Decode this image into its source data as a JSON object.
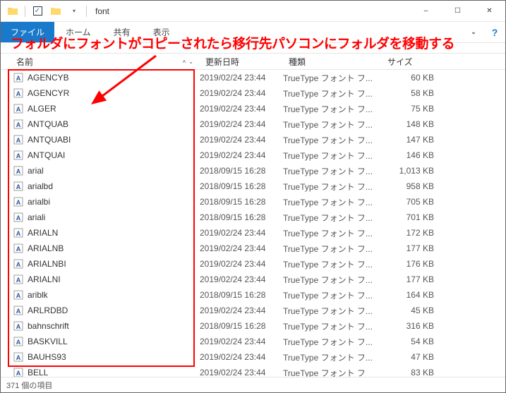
{
  "window": {
    "title": "font",
    "minimize": "–",
    "maximize": "☐",
    "close": "✕"
  },
  "ribbon": {
    "file": "ファイル",
    "home": "ホーム",
    "share": "共有",
    "view": "表示",
    "help": "?"
  },
  "annotation": "フォルダにフォントがコピーされたら移行先パソコンにフォルダを移動する",
  "columns": {
    "name": "名前",
    "date": "更新日時",
    "type": "種類",
    "size": "サイズ"
  },
  "files": [
    {
      "name": "AGENCYB",
      "date": "2019/02/24 23:44",
      "type": "TrueType フォント フ...",
      "size": "60 KB"
    },
    {
      "name": "AGENCYR",
      "date": "2019/02/24 23:44",
      "type": "TrueType フォント フ...",
      "size": "58 KB"
    },
    {
      "name": "ALGER",
      "date": "2019/02/24 23:44",
      "type": "TrueType フォント フ...",
      "size": "75 KB"
    },
    {
      "name": "ANTQUAB",
      "date": "2019/02/24 23:44",
      "type": "TrueType フォント フ...",
      "size": "148 KB"
    },
    {
      "name": "ANTQUABI",
      "date": "2019/02/24 23:44",
      "type": "TrueType フォント フ...",
      "size": "147 KB"
    },
    {
      "name": "ANTQUAI",
      "date": "2019/02/24 23:44",
      "type": "TrueType フォント フ...",
      "size": "146 KB"
    },
    {
      "name": "arial",
      "date": "2018/09/15 16:28",
      "type": "TrueType フォント フ...",
      "size": "1,013 KB"
    },
    {
      "name": "arialbd",
      "date": "2018/09/15 16:28",
      "type": "TrueType フォント フ...",
      "size": "958 KB"
    },
    {
      "name": "arialbi",
      "date": "2018/09/15 16:28",
      "type": "TrueType フォント フ...",
      "size": "705 KB"
    },
    {
      "name": "ariali",
      "date": "2018/09/15 16:28",
      "type": "TrueType フォント フ...",
      "size": "701 KB"
    },
    {
      "name": "ARIALN",
      "date": "2019/02/24 23:44",
      "type": "TrueType フォント フ...",
      "size": "172 KB"
    },
    {
      "name": "ARIALNB",
      "date": "2019/02/24 23:44",
      "type": "TrueType フォント フ...",
      "size": "177 KB"
    },
    {
      "name": "ARIALNBI",
      "date": "2019/02/24 23:44",
      "type": "TrueType フォント フ...",
      "size": "176 KB"
    },
    {
      "name": "ARIALNI",
      "date": "2019/02/24 23:44",
      "type": "TrueType フォント フ...",
      "size": "177 KB"
    },
    {
      "name": "ariblk",
      "date": "2018/09/15 16:28",
      "type": "TrueType フォント フ...",
      "size": "164 KB"
    },
    {
      "name": "ARLRDBD",
      "date": "2019/02/24 23:44",
      "type": "TrueType フォント フ...",
      "size": "45 KB"
    },
    {
      "name": "bahnschrift",
      "date": "2018/09/15 16:28",
      "type": "TrueType フォント フ...",
      "size": "316 KB"
    },
    {
      "name": "BASKVILL",
      "date": "2019/02/24 23:44",
      "type": "TrueType フォント フ...",
      "size": "54 KB"
    },
    {
      "name": "BAUHS93",
      "date": "2019/02/24 23:44",
      "type": "TrueType フォント フ...",
      "size": "47 KB"
    },
    {
      "name": "BELL",
      "date": "2019/02/24 23:44",
      "type": "TrueType フォント フ",
      "size": "83 KB"
    }
  ],
  "status": "371 個の項目"
}
